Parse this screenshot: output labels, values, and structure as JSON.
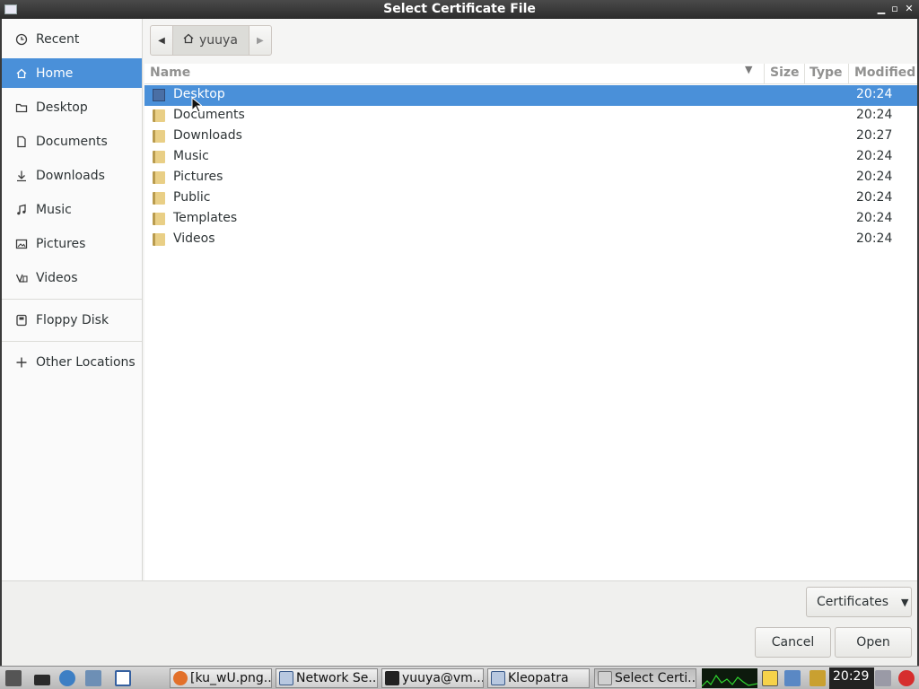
{
  "window": {
    "title": "Select Certificate File"
  },
  "sidebar": {
    "items": [
      {
        "label": "Recent",
        "icon": "clock-icon"
      },
      {
        "label": "Home",
        "icon": "home-icon"
      },
      {
        "label": "Desktop",
        "icon": "folder-icon"
      },
      {
        "label": "Documents",
        "icon": "document-icon"
      },
      {
        "label": "Downloads",
        "icon": "download-icon"
      },
      {
        "label": "Music",
        "icon": "music-icon"
      },
      {
        "label": "Pictures",
        "icon": "picture-icon"
      },
      {
        "label": "Videos",
        "icon": "video-icon"
      },
      {
        "label": "Floppy Disk",
        "icon": "floppy-icon"
      },
      {
        "label": "Other Locations",
        "icon": "plus-icon"
      }
    ],
    "active": "Home"
  },
  "pathbar": {
    "crumb": "yuuya"
  },
  "filelist": {
    "columns": [
      "Name",
      "Size",
      "Type",
      "Modified"
    ],
    "rows": [
      {
        "name": "Desktop",
        "modified": "20:24"
      },
      {
        "name": "Documents",
        "modified": "20:24"
      },
      {
        "name": "Downloads",
        "modified": "20:27"
      },
      {
        "name": "Music",
        "modified": "20:24"
      },
      {
        "name": "Pictures",
        "modified": "20:24"
      },
      {
        "name": "Public",
        "modified": "20:24"
      },
      {
        "name": "Templates",
        "modified": "20:24"
      },
      {
        "name": "Videos",
        "modified": "20:24"
      }
    ],
    "selected": "Desktop"
  },
  "filter": {
    "label": "Certificates"
  },
  "buttons": {
    "cancel": "Cancel",
    "open": "Open"
  },
  "taskbar": {
    "tasks": [
      {
        "label": "[ku_wU.png..."
      },
      {
        "label": "Network Se..."
      },
      {
        "label": "yuuya@vm..."
      },
      {
        "label": "Kleopatra"
      },
      {
        "label": "Select Certi..."
      }
    ],
    "clock": "20:29"
  }
}
